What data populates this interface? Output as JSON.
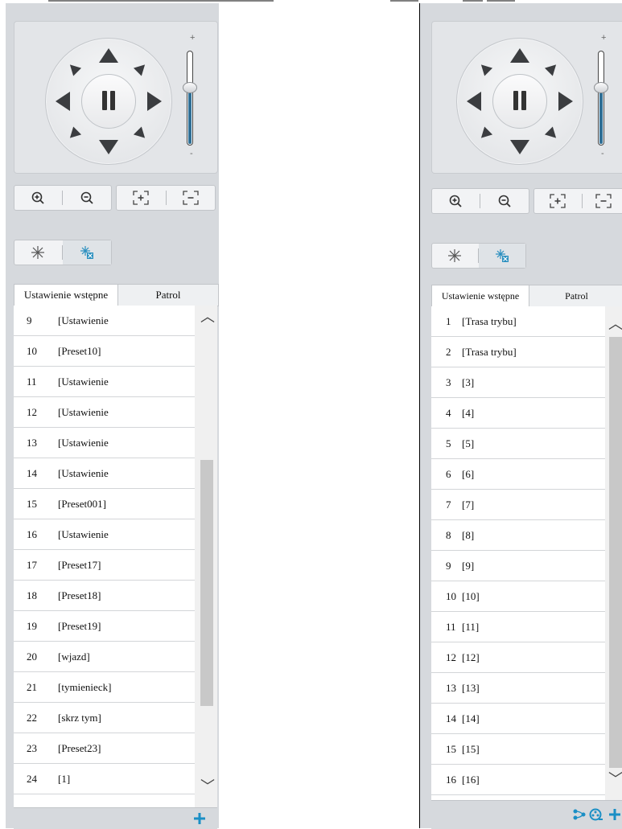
{
  "accent": "#1b8fc5",
  "ptz": {
    "zoom_plus": "+",
    "zoom_minus": "-",
    "icons": [
      "up-arrow",
      "down-arrow",
      "left-arrow",
      "right-arrow",
      "up-left-arrow",
      "up-right-arrow",
      "down-left-arrow",
      "down-right-arrow",
      "pause-icon"
    ],
    "zoom_level_fraction": 0.62
  },
  "zoom_toolbar": {
    "icons": [
      "zoom-in-icon",
      "zoom-out-icon",
      "focus-near-icon",
      "focus-far-icon"
    ]
  },
  "wiper_toolbar": {
    "icons": [
      "snowflake-icon",
      "defrost-icon"
    ]
  },
  "left_panel": {
    "tabs": [
      {
        "label": "Ustawienie wstępne",
        "active": true
      },
      {
        "label": "Patrol",
        "active": false
      }
    ],
    "rows": [
      {
        "num": "9",
        "name": "[Ustawienie"
      },
      {
        "num": "10",
        "name": "[Preset10]"
      },
      {
        "num": "11",
        "name": "[Ustawienie"
      },
      {
        "num": "12",
        "name": "[Ustawienie"
      },
      {
        "num": "13",
        "name": "[Ustawienie"
      },
      {
        "num": "14",
        "name": "[Ustawienie"
      },
      {
        "num": "15",
        "name": "[Preset001]"
      },
      {
        "num": "16",
        "name": "[Ustawienie"
      },
      {
        "num": "17",
        "name": "[Preset17]"
      },
      {
        "num": "18",
        "name": "[Preset18]"
      },
      {
        "num": "19",
        "name": "[Preset19]"
      },
      {
        "num": "20",
        "name": "[wjazd]"
      },
      {
        "num": "21",
        "name": "[tymienieck]"
      },
      {
        "num": "22",
        "name": "[skrz tym]"
      },
      {
        "num": "23",
        "name": "[Preset23]"
      },
      {
        "num": "24",
        "name": "[1]"
      }
    ],
    "footer_icons": [
      "add-icon"
    ]
  },
  "right_panel": {
    "tabs": [
      {
        "label": "Ustawienie wstępne",
        "active": true
      },
      {
        "label": "Patrol",
        "active": false
      }
    ],
    "rows": [
      {
        "num": "1",
        "name": "[Trasa trybu]"
      },
      {
        "num": "2",
        "name": "[Trasa trybu]"
      },
      {
        "num": "3",
        "name": "[3]"
      },
      {
        "num": "4",
        "name": "[4]"
      },
      {
        "num": "5",
        "name": "[5]"
      },
      {
        "num": "6",
        "name": "[6]"
      },
      {
        "num": "7",
        "name": "[7]"
      },
      {
        "num": "8",
        "name": "[8]"
      },
      {
        "num": "9",
        "name": "[9]"
      },
      {
        "num": "10",
        "name": "[10]"
      },
      {
        "num": "11",
        "name": "[11]"
      },
      {
        "num": "12",
        "name": "[12]"
      },
      {
        "num": "13",
        "name": "[13]"
      },
      {
        "num": "14",
        "name": "[14]"
      },
      {
        "num": "15",
        "name": "[15]"
      },
      {
        "num": "16",
        "name": "[16]"
      }
    ],
    "footer_icons": [
      "patrol-route-icon",
      "record-path-icon",
      "add-icon"
    ]
  }
}
